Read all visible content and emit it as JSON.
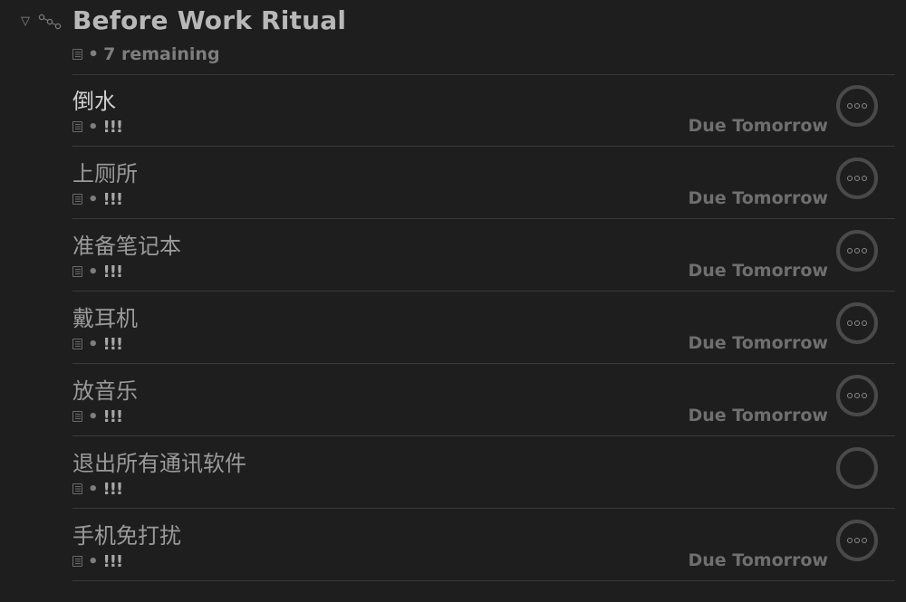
{
  "project": {
    "title": "Before Work Ritual",
    "remaining": "7 remaining",
    "separator": "•"
  },
  "tasks": [
    {
      "title": "倒水",
      "flag": "!!!",
      "due": "Due Tomorrow",
      "status": "defer"
    },
    {
      "title": "上厕所",
      "flag": "!!!",
      "due": "Due Tomorrow",
      "status": "defer"
    },
    {
      "title": "准备笔记本",
      "flag": "!!!",
      "due": "Due Tomorrow",
      "status": "defer"
    },
    {
      "title": "戴耳机",
      "flag": "!!!",
      "due": "Due Tomorrow",
      "status": "defer"
    },
    {
      "title": "放音乐",
      "flag": "!!!",
      "due": "Due Tomorrow",
      "status": "defer"
    },
    {
      "title": "退出所有通讯软件",
      "flag": "!!!",
      "due": "",
      "status": "empty"
    },
    {
      "title": "手机免打扰",
      "flag": "!!!",
      "due": "Due Tomorrow",
      "status": "defer"
    }
  ],
  "icons": {
    "disclosure": "disclosure-triangle-icon",
    "project": "project-sequential-icon",
    "note": "note-icon",
    "status_defer": "ellipsis-circle-icon",
    "status_empty": "empty-circle-icon"
  },
  "colors": {
    "background": "#1e1e1e",
    "title": "#b8b8b8",
    "text": "#9a9a9a",
    "muted": "#6f6f6f",
    "rule": "#3a3a3a"
  }
}
